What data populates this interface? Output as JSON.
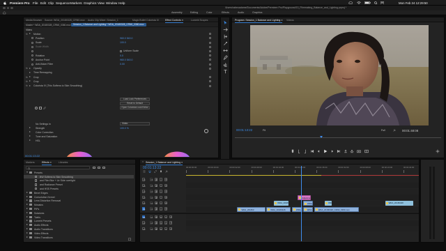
{
  "menubar": {
    "app_name": "Premiere Pro",
    "items": [
      "File",
      "Edit",
      "Clip",
      "Sequence",
      "Markers",
      "Graphics",
      "View",
      "Window",
      "Help"
    ],
    "clock": "Mon Feb 24  12:29:50"
  },
  "titlebar": {
    "path": "/Users/rabeoadame/Documents/Adobe/Premiere Pro/Playground/13_Filmmaking_Balance_and_Lighting.prproj *"
  },
  "workspaces": [
    "Assembly",
    "Editing",
    "Color",
    "Effects",
    "Audio",
    "Graphics"
  ],
  "source_panel": {
    "tabs": [
      "Media Browser",
      "Source: WDA_20180328_CRN0.mov",
      "Audio Clip Mixer: Session_1",
      "Magic Bullet Colorista IV",
      "Effect Controls ≡",
      "Lumetri Scopes"
    ],
    "active_tab": 4,
    "header_left": "Master * WDA_20180328_CRN0_0360.mov",
    "header_right": "Session_1 Balance and Lighting * WDA_20180328_CRN0_0360.mov",
    "section": "Video",
    "rows": [
      {
        "label": "Motion",
        "kind": "group",
        "fx": true
      },
      {
        "label": "Position",
        "value": "960.0  540.0",
        "kind": "prop"
      },
      {
        "label": "Scale",
        "value": "100.0",
        "kind": "prop"
      },
      {
        "label": "Scale Width",
        "value": "",
        "kind": "prop-dim"
      },
      {
        "label": "Uniform Scale",
        "value": "",
        "kind": "check"
      },
      {
        "label": "Rotation",
        "value": "0.0",
        "kind": "prop"
      },
      {
        "label": "Anchor Point",
        "value": "960.0  540.0",
        "kind": "prop"
      },
      {
        "label": "Anti-flicker Filter",
        "value": "0.00",
        "kind": "prop"
      },
      {
        "label": "Opacity",
        "kind": "group",
        "fx": true
      },
      {
        "label": "Time Remapping",
        "kind": "group",
        "fx": false
      },
      {
        "label": "Crop",
        "kind": "group",
        "fx": true
      },
      {
        "label": "Crop",
        "kind": "group",
        "fx": true
      },
      {
        "label": "Colorista IV (This Softens to Skin Smoothing)",
        "kind": "group",
        "fx": true
      }
    ],
    "buttons": [
      "Load Look Preferences",
      "Reset to Default",
      "Open Colorista Look Editor"
    ],
    "no_settings_label": "No Settings in",
    "no_settings_value": "Video",
    "strength_label": "Strength",
    "strength_value": "100.0 %",
    "color_correction": "Color Correction",
    "tone": "Tone and Saturation",
    "hsl": "HSL",
    "timecode": "00:01:13:22"
  },
  "program": {
    "tabs": [
      "Program: Session_1 Balance and Lighting ≡",
      "Videos"
    ],
    "current_tc": "00:01:13:22",
    "fit": "Fit",
    "quality": "Full",
    "duration_tc": "00:01:48:08",
    "playhead_fraction": 0.42
  },
  "effects": {
    "tabs": [
      "Markers",
      "Effects ≡",
      "Libraries"
    ],
    "active_tab": 1,
    "search_placeholder": "",
    "items": [
      {
        "label": "Presets",
        "level": 0,
        "open": true
      },
      {
        "label": "BW Softens to Skin Smoothing",
        "level": 1,
        "selected": true
      },
      {
        "label": "and Film Blur + Ltr Side overlight",
        "level": 1
      },
      {
        "label": "and Radiance Preset",
        "level": 1
      },
      {
        "label": "and HSS Presets",
        "level": 1
      },
      {
        "label": "Bevel Edges",
        "level": 0
      },
      {
        "label": "Convolution Kernel",
        "level": 0
      },
      {
        "label": "Lens Distortion Removal",
        "level": 0
      },
      {
        "label": "Mosaics",
        "level": 0
      },
      {
        "label": "PiPs",
        "level": 0
      },
      {
        "label": "Solarizes",
        "level": 0
      },
      {
        "label": "Twirls",
        "level": 0
      },
      {
        "label": "Lumetri Presets",
        "level": 0
      },
      {
        "label": "Audio Effects",
        "level": 0
      },
      {
        "label": "Audio Transitions",
        "level": 0
      },
      {
        "label": "Video Effects",
        "level": 0
      },
      {
        "label": "Video Transitions",
        "level": 0
      }
    ]
  },
  "timeline": {
    "tab": "Session_1 Balance and Lighting ≡",
    "timecode": "00:01:13:22",
    "ruler": [
      "00:00:00:00",
      "00:00:16:00",
      "00:00:32:00",
      "00:00:48:00",
      "00:01:04:00",
      "00:01:20:00",
      "00:01:36:00",
      "00:01:52:00",
      "00:02:08:00",
      "00:02:24:00",
      "00:02:40:00"
    ],
    "tracks": [
      "V6",
      "V5",
      "V4",
      "V3",
      "V2",
      "V1",
      "A1",
      "A2",
      "A3"
    ],
    "clips": [
      {
        "label": "Adjustment Layer",
        "track": "V3",
        "start": 0.48,
        "end": 0.535,
        "color": "#d978c7"
      },
      {
        "label": "WDA_20180328_CRN",
        "track": "V2",
        "start": 0.378,
        "end": 0.44,
        "kind": "g"
      },
      {
        "label": "WDA_",
        "track": "V2",
        "start": 0.503,
        "end": 0.545,
        "kind": "v"
      },
      {
        "label": "WDA_20180328_CRN",
        "track": "V2",
        "start": 0.596,
        "end": 0.625,
        "kind": "g"
      },
      {
        "label": "WDA_20180328",
        "track": "V2",
        "start": 0.855,
        "end": 0.975,
        "kind": "g"
      },
      {
        "label": "WDA_201803",
        "track": "V1",
        "start": 0.22,
        "end": 0.34,
        "kind": "v"
      },
      {
        "label": "WDA_20180328",
        "track": "V1",
        "start": 0.345,
        "end": 0.45,
        "kind": "v"
      },
      {
        "label": "WDA_2018",
        "track": "V1",
        "start": 0.455,
        "end": 0.5,
        "kind": "v"
      },
      {
        "label": "WDA_2018032",
        "track": "V1",
        "start": 0.502,
        "end": 0.545,
        "kind": "v"
      },
      {
        "label": "WDA_20180328_CRN0_0360.mov",
        "track": "V1",
        "start": 0.55,
        "end": 0.742,
        "kind": "v"
      }
    ],
    "playhead_fraction": 0.493
  },
  "colors": {
    "accent": "#3b82d6",
    "timecode": "#3b8dea",
    "playhead": "#3f8ef0"
  }
}
